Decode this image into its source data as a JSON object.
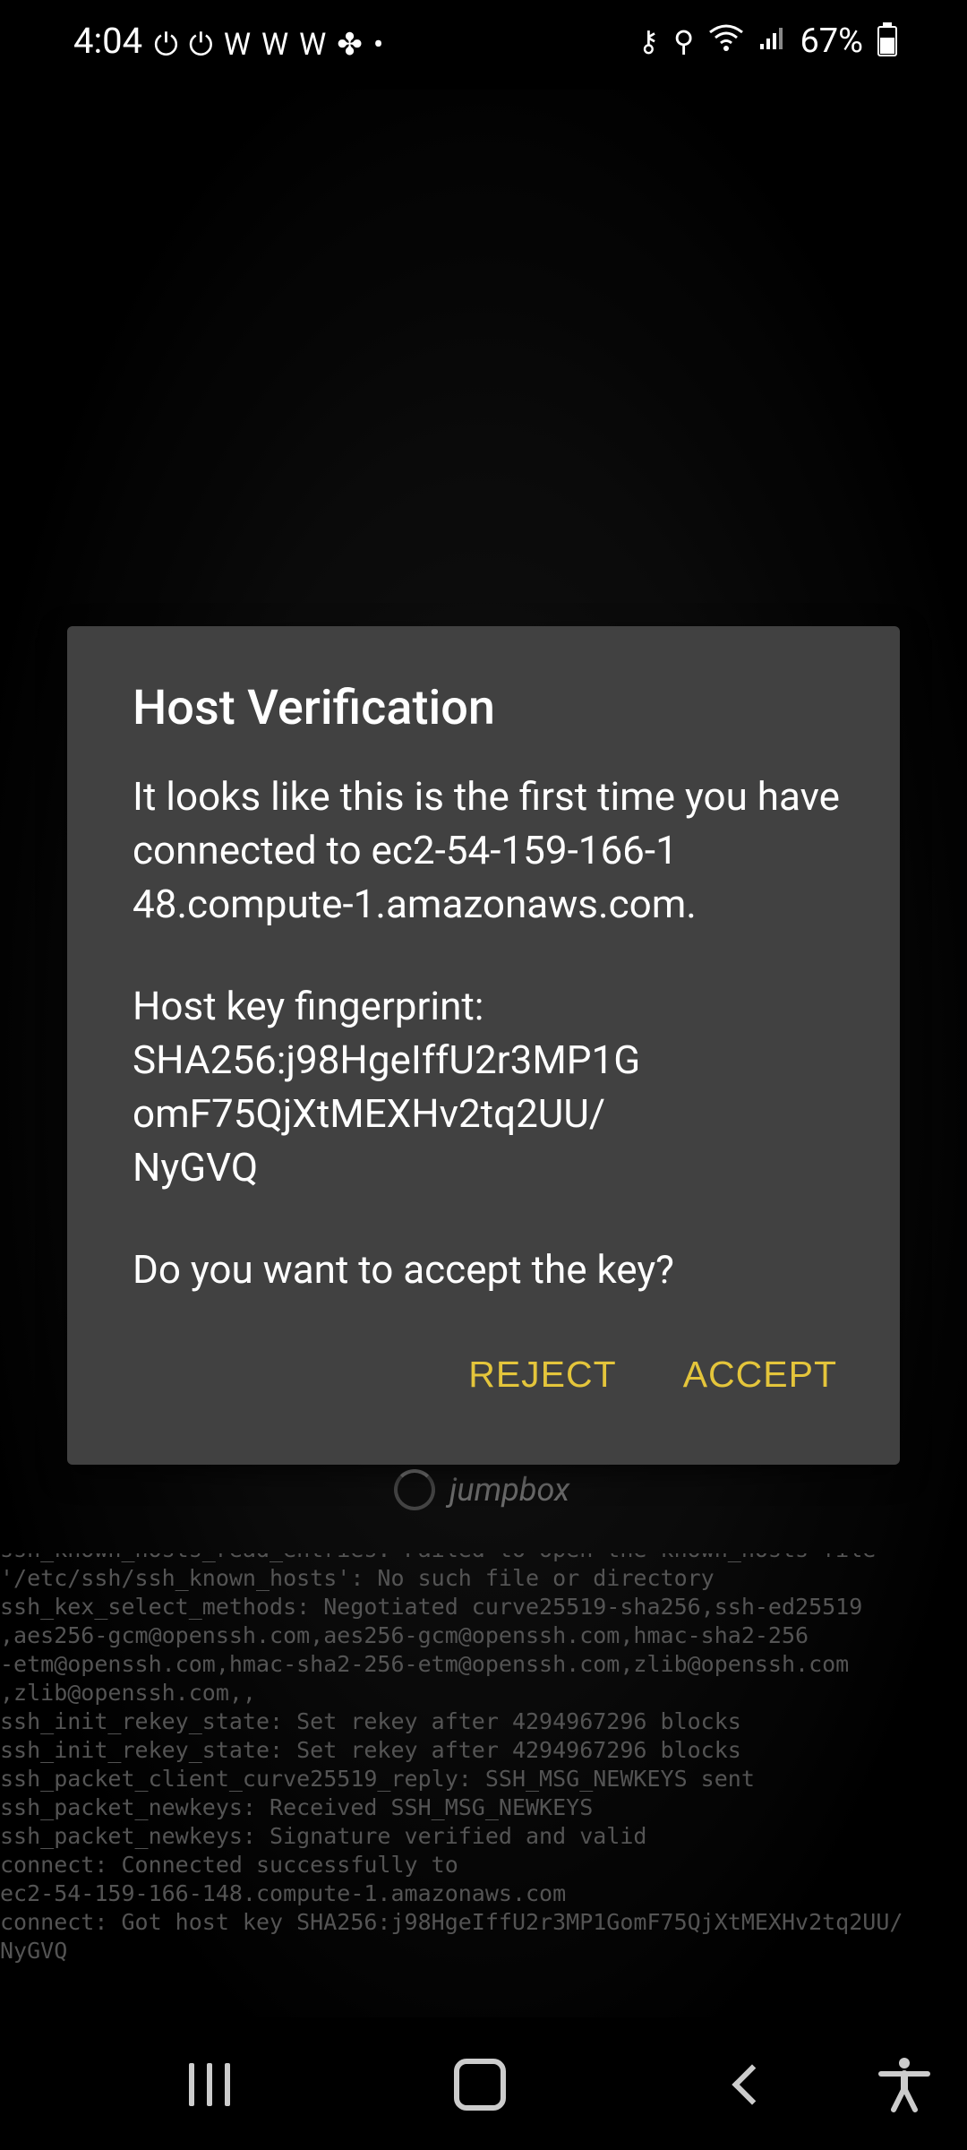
{
  "status_bar": {
    "time": "4:04",
    "left_icons": [
      "power-icon",
      "power-icon",
      "w-icon",
      "w-icon",
      "w-icon",
      "fan-icon",
      "dot-icon"
    ],
    "right_icons": [
      "key-icon",
      "location-icon",
      "wifi-icon",
      "signal-icon"
    ],
    "battery": "67%"
  },
  "dialog": {
    "title": "Host Verification",
    "message_1": "It looks like this is the first time you have connected to ec2-54-159-166-1​48.compute-1.amazonaws.com.",
    "fingerprint_label": "Host key fingerprint:",
    "fingerprint_1": "SHA256:j98HgeIffU2r3MP1G",
    "fingerprint_2": "omF75QjXtMEXHv2tq2UU/",
    "fingerprint_3": "NyGVQ",
    "question": "Do you want to accept the key?",
    "reject_label": "REJECT",
    "accept_label": "ACCEPT"
  },
  "connection": {
    "label": "jumpbox"
  },
  "log": {
    "lines": [
      "ssh_known_hosts_read_entries: Failed to open the known_hosts file",
      "'/etc/ssh/ssh_known_hosts': No such file or directory",
      "ssh_kex_select_methods: Negotiated curve25519-sha256,ssh-ed25519",
      ",aes256-gcm@openssh.com,aes256-gcm@openssh.com,hmac-sha2-256",
      "-etm@openssh.com,hmac-sha2-256-etm@openssh.com,zlib@openssh.com",
      ",zlib@openssh.com,,",
      "ssh_init_rekey_state: Set rekey after 4294967296 blocks",
      "ssh_init_rekey_state: Set rekey after 4294967296 blocks",
      "ssh_packet_client_curve25519_reply: SSH_MSG_NEWKEYS sent",
      "ssh_packet_newkeys: Received SSH_MSG_NEWKEYS",
      "ssh_packet_newkeys: Signature verified and valid",
      "connect: Connected successfully to",
      "ec2-54-159-166-148.compute-1.amazonaws.com",
      "connect: Got host key SHA256:j98HgeIffU2r3MP1GomF75QjXtMEXHv2tq2UU/",
      "NyGVQ"
    ]
  },
  "nav": {
    "recent": "recent-apps",
    "home": "home",
    "back": "back",
    "accessibility": "accessibility"
  }
}
